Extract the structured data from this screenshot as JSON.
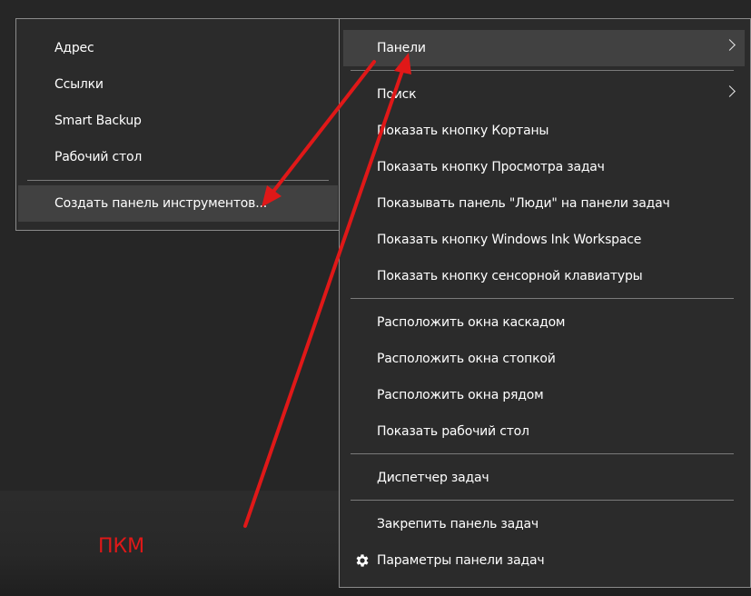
{
  "submenu": {
    "items": [
      {
        "label": "Адрес"
      },
      {
        "label": "Ссылки"
      },
      {
        "label": "Smart Backup"
      },
      {
        "label": "Рабочий стол"
      },
      {
        "label": "Создать панель инструментов..."
      }
    ]
  },
  "mainmenu": {
    "panels": "Панели",
    "search": "Поиск",
    "group1": [
      "Показать кнопку Кортаны",
      "Показать кнопку Просмотра задач",
      "Показывать панель \"Люди\" на панели задач",
      "Показать кнопку Windows Ink Workspace",
      "Показать кнопку сенсорной клавиатуры"
    ],
    "group2": [
      "Расположить окна каскадом",
      "Расположить окна стопкой",
      "Расположить окна рядом",
      "Показать рабочий стол"
    ],
    "task_manager": "Диспетчер задач",
    "pin_taskbar": "Закрепить панель задач",
    "taskbar_settings": "Параметры панели задач"
  },
  "annotation": {
    "label": "ПКМ",
    "color": "#e01818"
  },
  "icons": {
    "chevron": "chevron-right-icon",
    "settings": "gear-icon"
  }
}
